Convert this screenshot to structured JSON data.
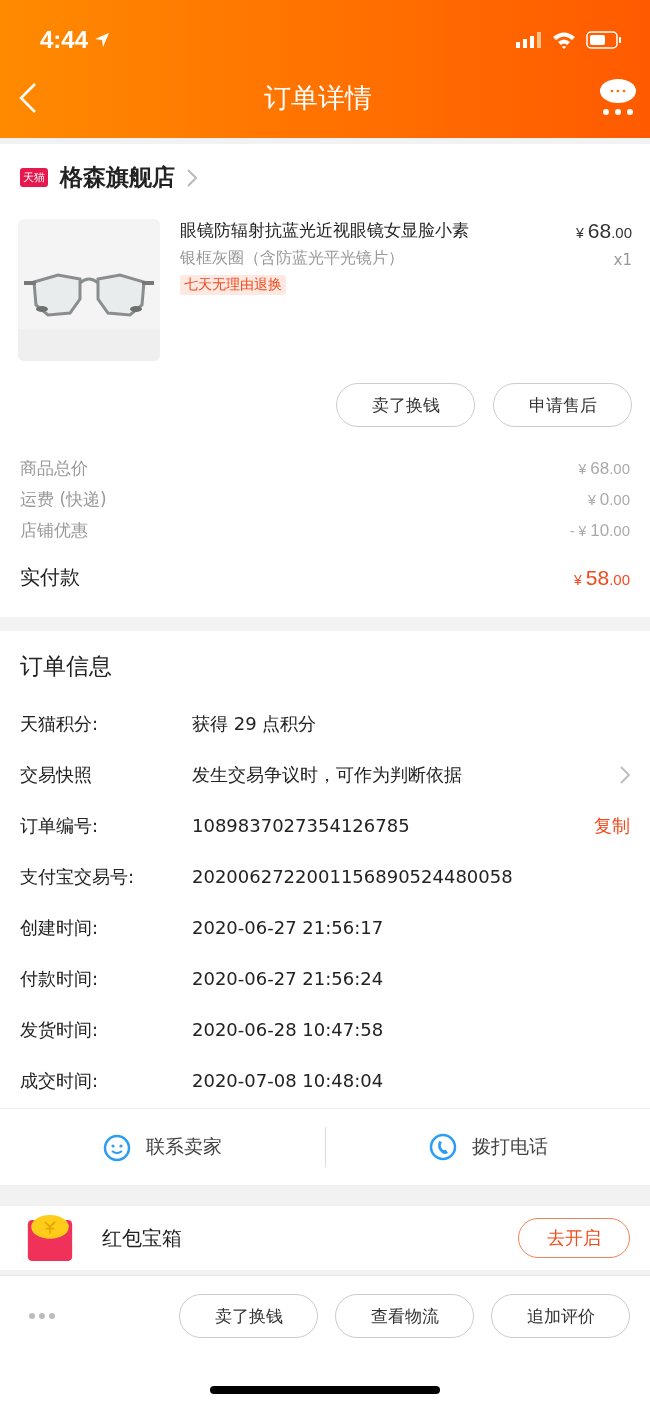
{
  "status_bar": {
    "time": "4:44"
  },
  "nav": {
    "title": "订单详情"
  },
  "store": {
    "badge": "天猫",
    "name": "格森旗舰店"
  },
  "product": {
    "kind": "picture",
    "title": "眼镜防辐射抗蓝光近视眼镜女显脸小素",
    "variant": "银框灰圈（含防蓝光平光镜片）",
    "tag": "七天无理由退换",
    "price": {
      "symbol": "¥",
      "integer": "68",
      "decimal": ".00"
    },
    "quantity": "x1"
  },
  "product_buttons": [
    "卖了换钱",
    "申请售后"
  ],
  "costs": [
    {
      "label": "商品总价",
      "price": {
        "symbol": "¥",
        "integer": "68",
        "decimal": ".00"
      }
    },
    {
      "label": "运费 (快递)",
      "price": {
        "symbol": "¥",
        "integer": "0",
        "decimal": ".00"
      }
    },
    {
      "label": "店铺优惠",
      "price": {
        "symbol": "- ¥",
        "integer": "10",
        "decimal": ".00"
      }
    }
  ],
  "total": {
    "label": "实付款",
    "price": {
      "symbol": "¥",
      "integer": "58",
      "decimal": ".00"
    }
  },
  "order_info": {
    "title": "订单信息",
    "rows": [
      {
        "label": "天猫积分:",
        "value": "获得 29 点积分"
      },
      {
        "label": "交易快照",
        "value": "发生交易争议时，可作为判断依据",
        "kind": "link"
      },
      {
        "label": "订单编号:",
        "value": "1089837027354126785",
        "action": "复制"
      },
      {
        "label": "支付宝交易号:",
        "value": "2020062722001156890524480058"
      },
      {
        "label": "创建时间:",
        "value": "2020-06-27 21:56:17"
      },
      {
        "label": "付款时间:",
        "value": "2020-06-27 21:56:24"
      },
      {
        "label": "发货时间:",
        "value": "2020-06-28 10:47:58"
      },
      {
        "label": "成交时间:",
        "value": "2020-07-08 10:48:04"
      }
    ]
  },
  "contact": [
    {
      "kind": "seller",
      "label": "联系卖家"
    },
    {
      "kind": "phone",
      "label": "拨打电话"
    }
  ],
  "red_packet": {
    "title": "红包宝箱",
    "button": "去开启"
  },
  "bottom_bar": {
    "buttons": [
      "卖了换钱",
      "查看物流",
      "追加评价"
    ]
  }
}
